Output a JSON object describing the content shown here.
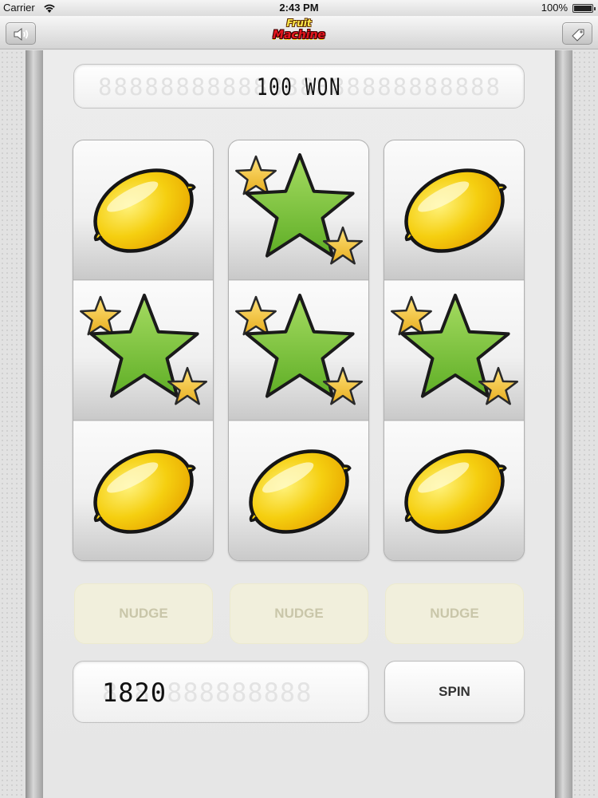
{
  "status_bar": {
    "carrier": "Carrier",
    "time": "2:43 PM",
    "battery": "100%",
    "icons": [
      "wifi-icon",
      "battery-icon"
    ]
  },
  "nav_bar": {
    "logo_top": "Fruit",
    "logo_bottom": "Machine",
    "left_button_icon": "speaker-icon",
    "right_button_icon": "price-tag-icon"
  },
  "display": {
    "message": "100 WON",
    "lcd_background": "88888888888888888888888888"
  },
  "reels": [
    [
      "lemon",
      "star",
      "lemon"
    ],
    [
      "star",
      "star",
      "lemon"
    ],
    [
      "lemon",
      "star",
      "lemon"
    ]
  ],
  "nudge_buttons": [
    "NUDGE",
    "NUDGE",
    "NUDGE"
  ],
  "credits": {
    "value": "1820",
    "lcd_background": "8888888888888"
  },
  "spin_label": "SPIN",
  "colors": {
    "lemon": "#f5cf10",
    "star_green": "#7fc63c",
    "star_gold": "#f2c73a",
    "nudge_bg": "#f1efdc",
    "logo_red": "#e5161e"
  }
}
